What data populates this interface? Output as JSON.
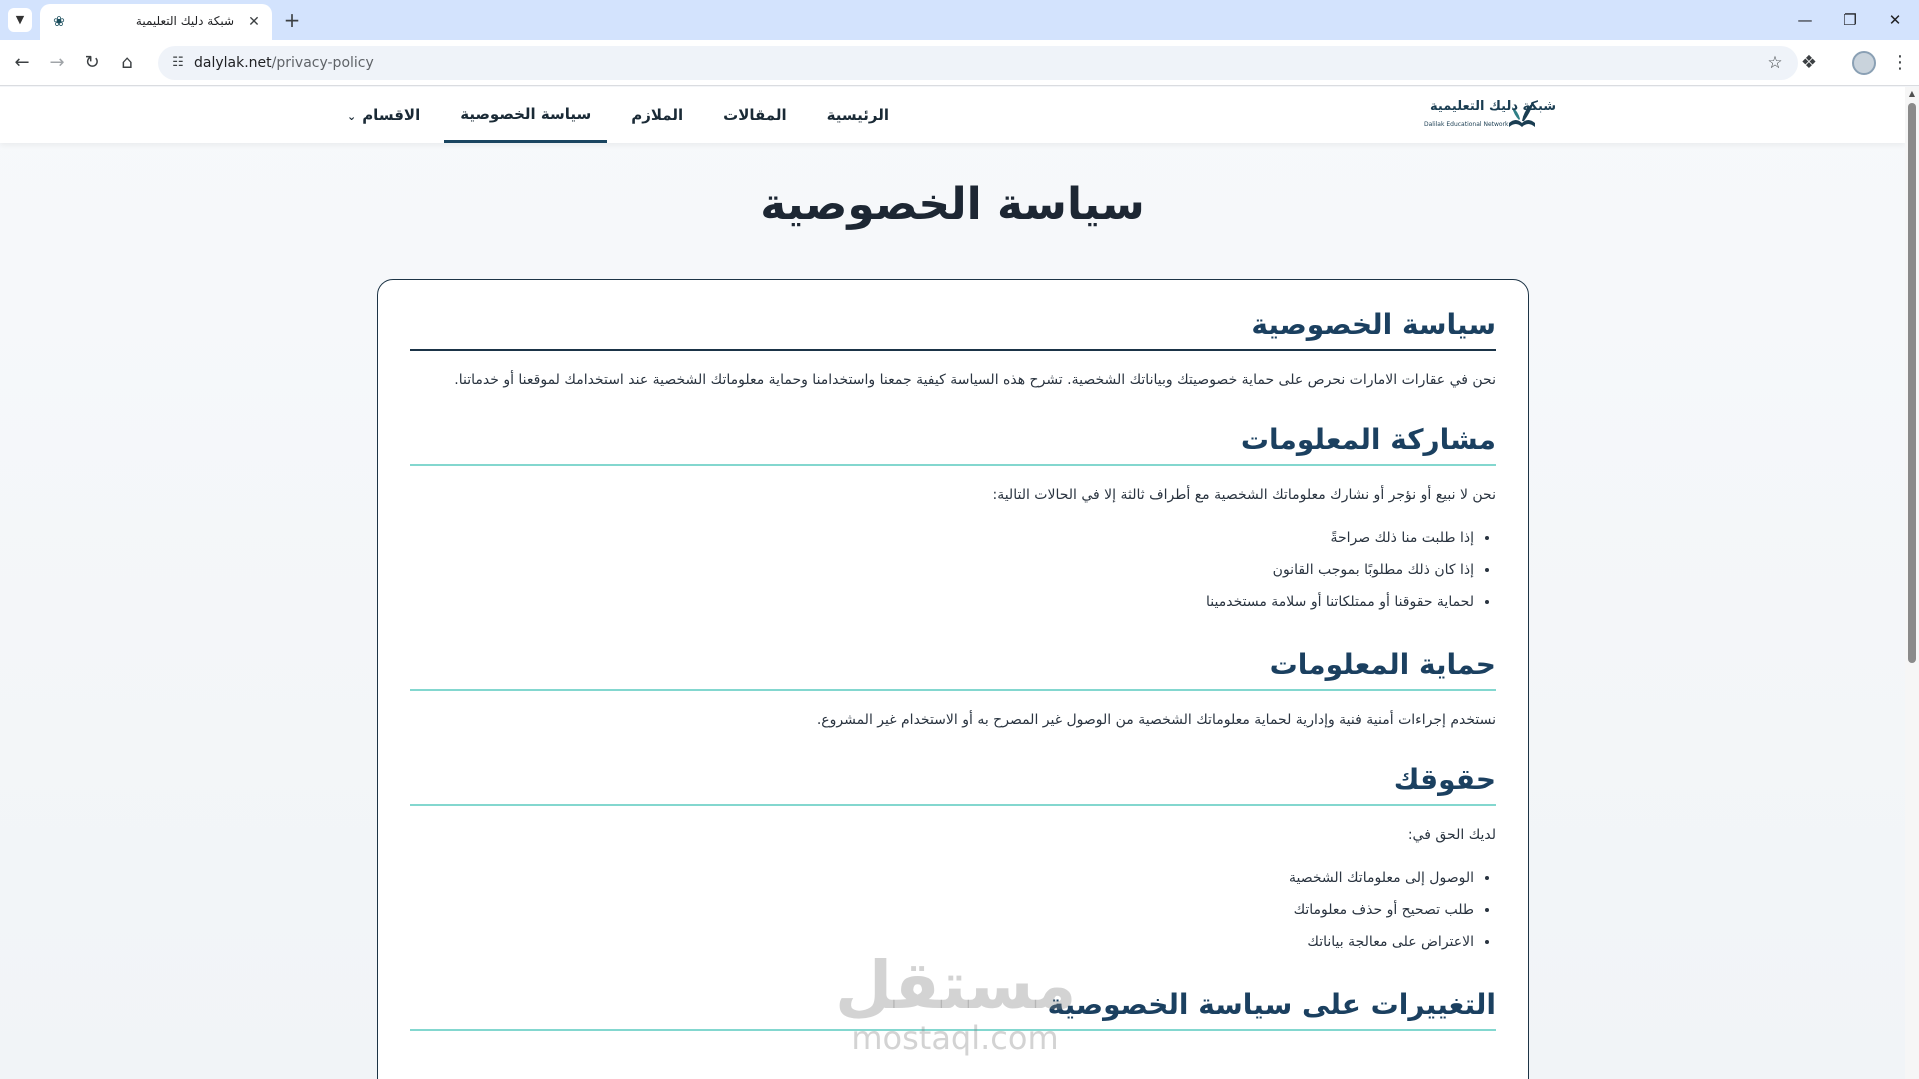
{
  "browser": {
    "tab_title": "شبكة دليك التعليمية",
    "url_domain": "dalylak.net",
    "url_path": "/privacy-policy",
    "icons": {
      "tab_dropdown": "chevron-down-icon",
      "close": "close-icon",
      "new_tab": "plus-icon",
      "back": "back-arrow-icon",
      "forward": "forward-arrow-icon",
      "reload": "reload-icon",
      "home": "home-icon",
      "site_info": "tune-icon",
      "bookmark": "star-icon",
      "extensions": "puzzle-icon",
      "menu": "kebab-icon"
    }
  },
  "site": {
    "logo_text": "شبكة دليك التعليمية",
    "logo_subtext": "Dalilak Educational Network",
    "nav": [
      {
        "label": "الرئيسية"
      },
      {
        "label": "المقالات"
      },
      {
        "label": "الملازم"
      },
      {
        "label": "سياسة الخصوصية",
        "active": true
      },
      {
        "label": "الاقسام",
        "dropdown": true
      }
    ]
  },
  "page": {
    "title": "سياسة الخصوصية",
    "sections": [
      {
        "title": "سياسة الخصوصية",
        "paragraph": "نحن في عقارات الامارات نحرص على حماية خصوصيتك وبياناتك الشخصية. تشرح هذه السياسة كيفية جمعنا واستخدامنا وحماية معلوماتك الشخصية عند استخدامك لموقعنا أو خدماتنا."
      },
      {
        "title": "مشاركة المعلومات",
        "paragraph": "نحن لا نبيع أو نؤجر أو نشارك معلوماتك الشخصية مع أطراف ثالثة إلا في الحالات التالية:",
        "items": [
          "إذا طلبت منا ذلك صراحةً",
          "إذا كان ذلك مطلوبًا بموجب القانون",
          "لحماية حقوقنا أو ممتلكاتنا أو سلامة مستخدمينا"
        ]
      },
      {
        "title": "حماية المعلومات",
        "paragraph": "نستخدم إجراءات أمنية فنية وإدارية لحماية معلوماتك الشخصية من الوصول غير المصرح به أو الاستخدام غير المشروع."
      },
      {
        "title": "حقوقك",
        "paragraph": "لديك الحق في:",
        "items": [
          "الوصول إلى معلوماتك الشخصية",
          "طلب تصحيح أو حذف معلوماتك",
          "الاعتراض على معالجة بياناتك"
        ]
      },
      {
        "title": "التغييرات على سياسة الخصوصية"
      }
    ]
  },
  "watermark": {
    "line1": "مستقل",
    "line2": "mostaql.com"
  }
}
